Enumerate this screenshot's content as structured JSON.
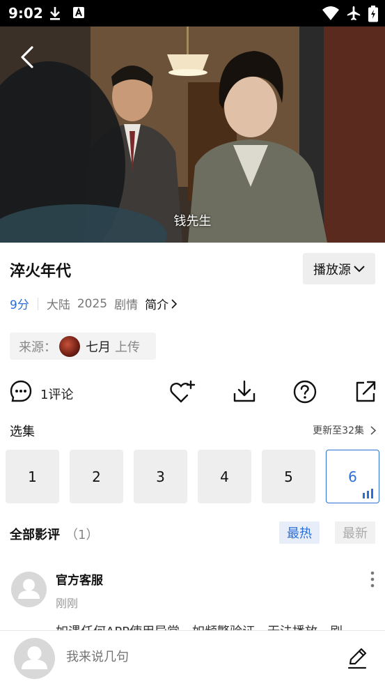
{
  "status_bar": {
    "time": "9:02",
    "icons": [
      "download-icon",
      "text-a-icon",
      "wifi-icon",
      "airplane-icon",
      "battery-charging-icon"
    ]
  },
  "video": {
    "subtitle": "钱先生",
    "back_icon": "chevron-left-icon"
  },
  "show": {
    "title": "淬火年代",
    "source_button": "播放源",
    "score": "9分",
    "region": "大陆",
    "year": "2025",
    "genre": "剧情",
    "intro_label": "简介"
  },
  "uploader": {
    "prefix": "来源：",
    "name": "七月",
    "suffix": "上传"
  },
  "actions": {
    "comments_label": "1评论",
    "icons": [
      "comment-icon",
      "favorite-add-icon",
      "download-icon",
      "help-icon",
      "share-icon"
    ]
  },
  "episodes": {
    "label": "选集",
    "update_info": "更新至32集",
    "items": [
      "1",
      "2",
      "3",
      "4",
      "5",
      "6"
    ],
    "active": "6"
  },
  "reviews": {
    "title": "全部影评",
    "count": "（1）",
    "sort_hot": "最热",
    "sort_new": "最新",
    "items": [
      {
        "author": "官方客服",
        "time": "刚刚",
        "text": "如遇任何APP使用异常，如频繁验证、无法播放，刷"
      }
    ]
  },
  "composer": {
    "placeholder": "我来说几句"
  },
  "colors": {
    "accent": "#2b6fd6",
    "chip_bg": "#eeeeee",
    "muted_text": "#999999"
  }
}
